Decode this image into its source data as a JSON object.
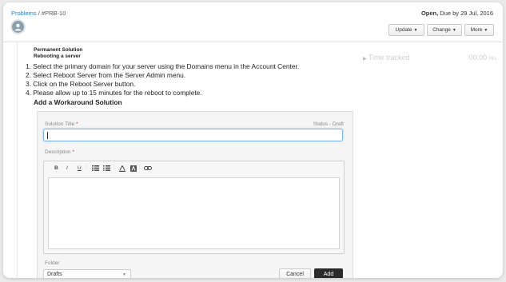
{
  "breadcrumb": {
    "parent": "Problems",
    "separator": " / ",
    "current": "#PRB-10"
  },
  "status": {
    "state": "Open,",
    "due": " Due by 29 Jul, 2016"
  },
  "actions": [
    {
      "label": "Update"
    },
    {
      "label": "Change"
    },
    {
      "label": "More"
    }
  ],
  "solution": {
    "heading": "Permanent Solution",
    "subheading": "Rebooting a server",
    "steps": [
      "1. Select the primary domain for your server using the Domains menu in the Account Center.",
      "2. Select Reboot Server from the Server Admin menu.",
      "3. Click on the Reboot Server button.",
      "4. Please allow up to 15 minutes for the reboot to complete."
    ]
  },
  "time_tracked": {
    "label": "Time tracked",
    "value": "00:00",
    "unit": "Hrs"
  },
  "workaround": {
    "title": "Add a Workaround Solution",
    "solution_title_label": "Solution Title",
    "status_label": "Status - Draft",
    "description_label": "Description",
    "toolbar": [
      "B",
      "I",
      "U"
    ],
    "folder_label": "Folder",
    "folder_value": "Drafts",
    "cancel_label": "Cancel",
    "add_label": "Add"
  },
  "colors": {
    "link": "#2a7fc1",
    "required": "#d9342b",
    "add_button": "#2b2b2b",
    "input_focus": "#7fb6e6"
  },
  "icons": [
    "avatar-icon",
    "caret-down-icon",
    "chevron-right-icon",
    "bullet-list-icon",
    "numbered-list-icon",
    "font-color-icon",
    "background-color-icon",
    "link-icon"
  ]
}
